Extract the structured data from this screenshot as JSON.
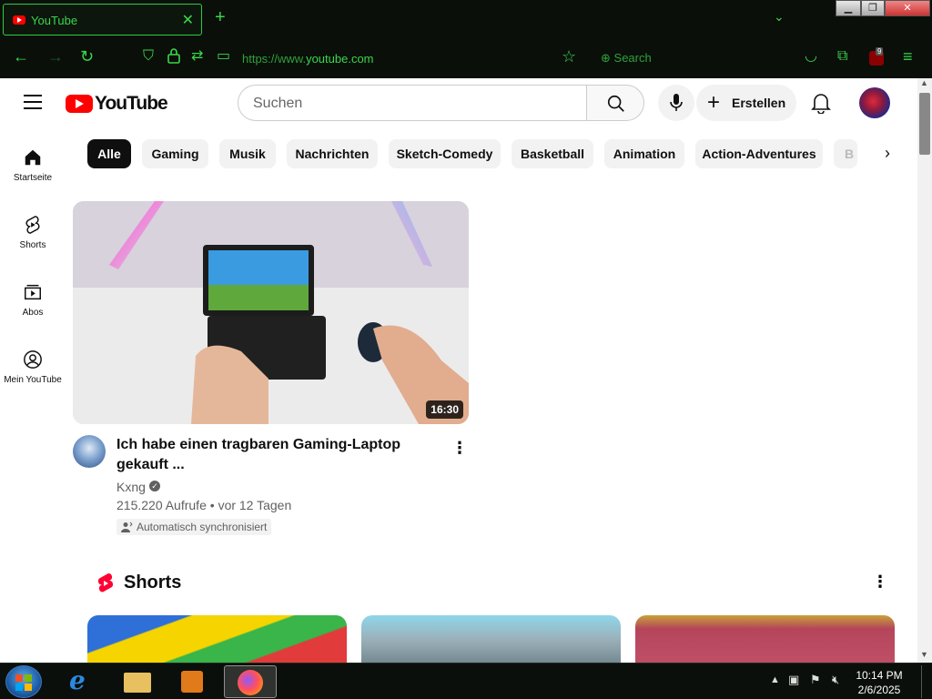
{
  "browser": {
    "tab_title": "YouTube",
    "url_prefix": "https://www.",
    "url_domain": "youtube.com",
    "search_label": "Search",
    "addon_badge": "9",
    "accent_color": "#3ad74a"
  },
  "youtube": {
    "logo_text": "YouTube",
    "search_placeholder": "Suchen",
    "create_label": "Erstellen",
    "nav": [
      {
        "label": "Startseite",
        "icon": "home-icon"
      },
      {
        "label": "Shorts",
        "icon": "shorts-icon"
      },
      {
        "label": "Abos",
        "icon": "subscriptions-icon"
      },
      {
        "label": "Mein YouTube",
        "icon": "account-icon"
      }
    ],
    "chips": [
      "Alle",
      "Gaming",
      "Musik",
      "Nachrichten",
      "Sketch-Comedy",
      "Basketball",
      "Animation",
      "Action-Adventures",
      "B"
    ],
    "video": {
      "title": "Ich habe einen tragbaren Gaming-Laptop gekauft ...",
      "duration": "16:30",
      "channel": "Kxng",
      "views": "215.220 Aufrufe",
      "age": "vor 12 Tagen",
      "badge": "Automatisch synchronisiert"
    },
    "shorts_title": "Shorts"
  },
  "taskbar": {
    "time": "10:14 PM",
    "date": "2/6/2025"
  }
}
